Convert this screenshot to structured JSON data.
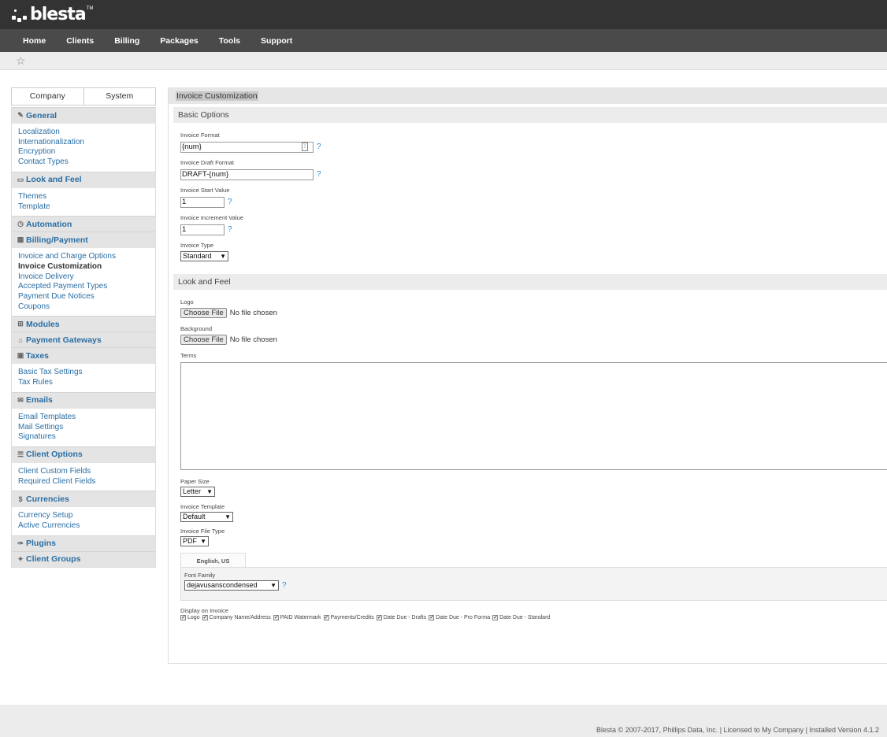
{
  "brand": {
    "name": "blesta",
    "tm": "TM"
  },
  "nav": [
    "Home",
    "Clients",
    "Billing",
    "Packages",
    "Tools",
    "Support"
  ],
  "sidebar": {
    "tabs": [
      "Company",
      "System"
    ],
    "sections": [
      {
        "title": "General",
        "icon": "wrench-icon",
        "glyph": "✎",
        "links": [
          "Localization",
          "Internationalization",
          "Encryption",
          "Contact Types"
        ]
      },
      {
        "title": "Look and Feel",
        "icon": "monitor-icon",
        "glyph": "▭",
        "links": [
          "Themes",
          "Template"
        ]
      },
      {
        "title": "Automation",
        "icon": "clock-icon",
        "glyph": "◷",
        "links": []
      },
      {
        "title": "Billing/Payment",
        "icon": "calculator-icon",
        "glyph": "▦",
        "links": [
          "Invoice and Charge Options",
          "Invoice Customization",
          "Invoice Delivery",
          "Accepted Payment Types",
          "Payment Due Notices",
          "Coupons"
        ],
        "active": 1
      },
      {
        "title": "Modules",
        "icon": "sitemap-icon",
        "glyph": "⊞",
        "links": []
      },
      {
        "title": "Payment Gateways",
        "icon": "bank-icon",
        "glyph": "⌂",
        "links": []
      },
      {
        "title": "Taxes",
        "icon": "money-icon",
        "glyph": "▣",
        "links": [
          "Basic Tax Settings",
          "Tax Rules"
        ]
      },
      {
        "title": "Emails",
        "icon": "envelope-icon",
        "glyph": "✉",
        "links": [
          "Email Templates",
          "Mail Settings",
          "Signatures"
        ]
      },
      {
        "title": "Client Options",
        "icon": "sliders-icon",
        "glyph": "☰",
        "links": [
          "Client Custom Fields",
          "Required Client Fields"
        ]
      },
      {
        "title": "Currencies",
        "icon": "dollar-icon",
        "glyph": "$",
        "links": [
          "Currency Setup",
          "Active Currencies"
        ]
      },
      {
        "title": "Plugins",
        "icon": "plug-icon",
        "glyph": "✑",
        "links": []
      },
      {
        "title": "Client Groups",
        "icon": "users-icon",
        "glyph": "✦",
        "links": []
      }
    ]
  },
  "main": {
    "title": "Invoice Customization",
    "basic_options": "Basic Options",
    "invoice_format": {
      "label": "Invoice Format",
      "value": "{num}"
    },
    "invoice_draft_format": {
      "label": "Invoice Draft Format",
      "value": "DRAFT-{num}"
    },
    "invoice_start_value": {
      "label": "Invoice Start Value",
      "value": "1"
    },
    "invoice_increment_value": {
      "label": "Invoice Increment Value",
      "value": "1"
    },
    "invoice_type": {
      "label": "Invoice Type",
      "value": "Standard"
    },
    "help": "?",
    "look_and_feel": "Look and Feel",
    "logo": {
      "label": "Logo",
      "button": "Choose File",
      "status": "No file chosen"
    },
    "background": {
      "label": "Background",
      "button": "Choose File",
      "status": "No file chosen"
    },
    "terms": {
      "label": "Terms",
      "value": ""
    },
    "paper_size": {
      "label": "Paper Size",
      "value": "Letter"
    },
    "invoice_template": {
      "label": "Invoice Template",
      "value": "Default"
    },
    "invoice_file_type": {
      "label": "Invoice File Type",
      "value": "PDF"
    },
    "language_tab": "English, US",
    "font_family": {
      "label": "Font Family",
      "value": "dejavusanscondensed"
    },
    "display_on_invoice": {
      "label": "Display on Invoice",
      "options": [
        "Logo",
        "Company Name/Address",
        "PAID Watermark",
        "Payments/Credits",
        "Date Due - Drafts",
        "Date Due - Pro Forma",
        "Date Due - Standard"
      ],
      "checked": [
        true,
        true,
        true,
        true,
        true,
        true,
        true
      ]
    }
  },
  "footer": "Blesta © 2007-2017, Phillips Data, Inc. | Licensed to My Company | Installed Version 4.1.2",
  "colors": {
    "header": "#333333",
    "nav": "#4a4a4a",
    "link": "#2a6ea4",
    "help": "#2a8ad4"
  }
}
